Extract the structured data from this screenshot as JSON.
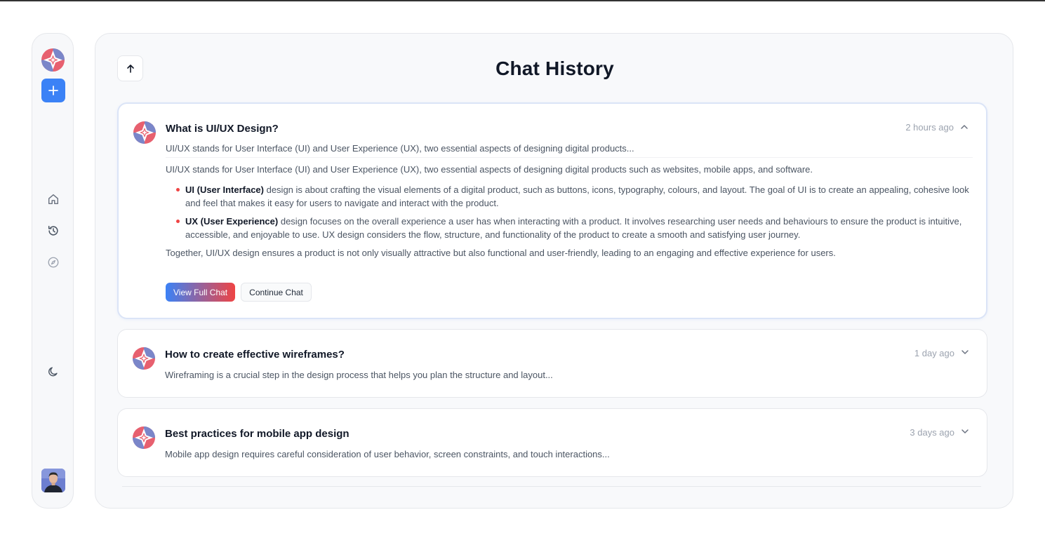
{
  "sidebar": {
    "new_chat_icon": "plus-icon",
    "nav": [
      "home-icon",
      "history-icon",
      "compass-icon"
    ],
    "theme_icon": "moon-icon",
    "accent": "#3b82f6"
  },
  "header": {
    "title": "Chat History",
    "back_icon": "arrow-up-icon"
  },
  "chats": [
    {
      "title": "What is UI/UX Design?",
      "time": "2 hours ago",
      "snippet": "UI/UX stands for User Interface (UI) and User Experience (UX), two essential aspects of designing digital products...",
      "expanded": true,
      "detail": {
        "intro": "UI/UX stands for User Interface (UI) and User Experience (UX), two essential aspects of designing digital products such as websites, mobile apps, and software.",
        "points": [
          {
            "term": "UI (User Interface)",
            "text": " design is about crafting the visual elements of a digital product, such as buttons, icons, typography, colours, and layout. The goal of UI is to create an appealing, cohesive look and feel that makes it easy for users to navigate and interact with the product."
          },
          {
            "term": "UX (User Experience)",
            "text": " design focuses on the overall experience a user has when interacting with a product. It involves researching user needs and behaviours to ensure the product is intuitive, accessible, and enjoyable to use. UX design considers the flow, structure, and functionality of the product to create a smooth and satisfying user journey."
          }
        ],
        "conclusion": "Together, UI/UX design ensures a product is not only visually attractive but also functional and user-friendly, leading to an engaging and effective experience for users."
      },
      "actions": {
        "view": "View Full Chat",
        "continue": "Continue Chat"
      }
    },
    {
      "title": "How to create effective wireframes?",
      "time": "1 day ago",
      "snippet": "Wireframing is a crucial step in the design process that helps you plan the structure and layout...",
      "expanded": false
    },
    {
      "title": "Best practices for mobile app design",
      "time": "3 days ago",
      "snippet": "Mobile app design requires careful consideration of user behavior, screen constraints, and touch interactions...",
      "expanded": false
    }
  ]
}
